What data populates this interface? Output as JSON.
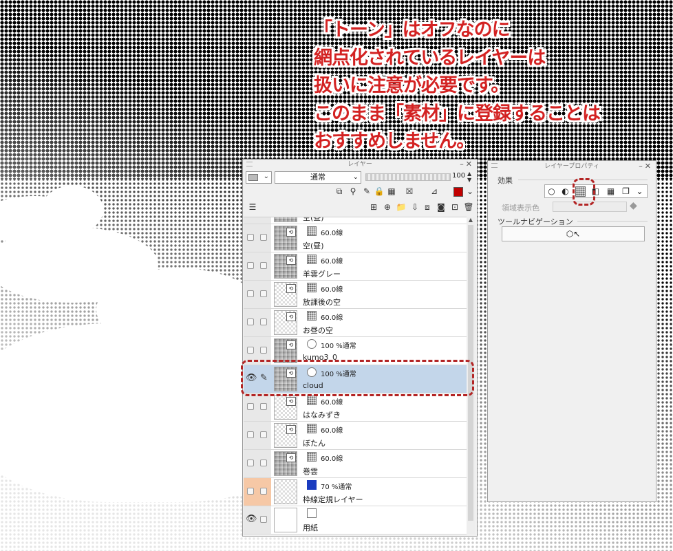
{
  "annotation": {
    "lines": [
      "「トーン」はオフなのに",
      "網点化されているレイヤーは",
      "扱いに注意が必要です。",
      "このまま「素材」に登録することは",
      "おすすめしません。"
    ]
  },
  "layer_panel": {
    "title": "レイヤー",
    "blend_mode": "通常",
    "opacity": "100",
    "layers": [
      {
        "mode": "60.0線",
        "name": "空(昼)",
        "selected": false,
        "visible": false
      },
      {
        "mode": "60.0線",
        "name": "羊雲グレー",
        "selected": false,
        "visible": false
      },
      {
        "mode": "60.0線",
        "name": "放課後の空",
        "selected": false,
        "visible": false
      },
      {
        "mode": "60.0線",
        "name": "お昼の空",
        "selected": false,
        "visible": false
      },
      {
        "mode": "100 %通常",
        "name": "kumo3_0",
        "selected": false,
        "visible": false
      },
      {
        "mode": "100 %通常",
        "name": "cloud",
        "selected": true,
        "visible": true
      },
      {
        "mode": "60.0線",
        "name": "はなみずき",
        "selected": false,
        "visible": false
      },
      {
        "mode": "60.0線",
        "name": "ぼたん",
        "selected": false,
        "visible": false
      },
      {
        "mode": "60.0線",
        "name": "巻雲",
        "selected": false,
        "visible": false
      },
      {
        "mode": "70 %通常",
        "name": "枠線定規レイヤー",
        "selected": false,
        "visible": false
      },
      {
        "mode": "",
        "name": "用紙",
        "selected": false,
        "visible": true
      }
    ],
    "partial_top_label": "空(昼)"
  },
  "property_panel": {
    "title": "レイヤープロパティ",
    "effect_label": "効果",
    "region_color_label": "領域表示色",
    "tool_nav_label": "ツールナビゲーション"
  },
  "colors": {
    "annotation_red": "#d32222",
    "highlight_red": "#b32424",
    "selected_row": "#c3d6ea",
    "border_layer": "#f6c8a6",
    "color_indicator": "#c00000"
  }
}
